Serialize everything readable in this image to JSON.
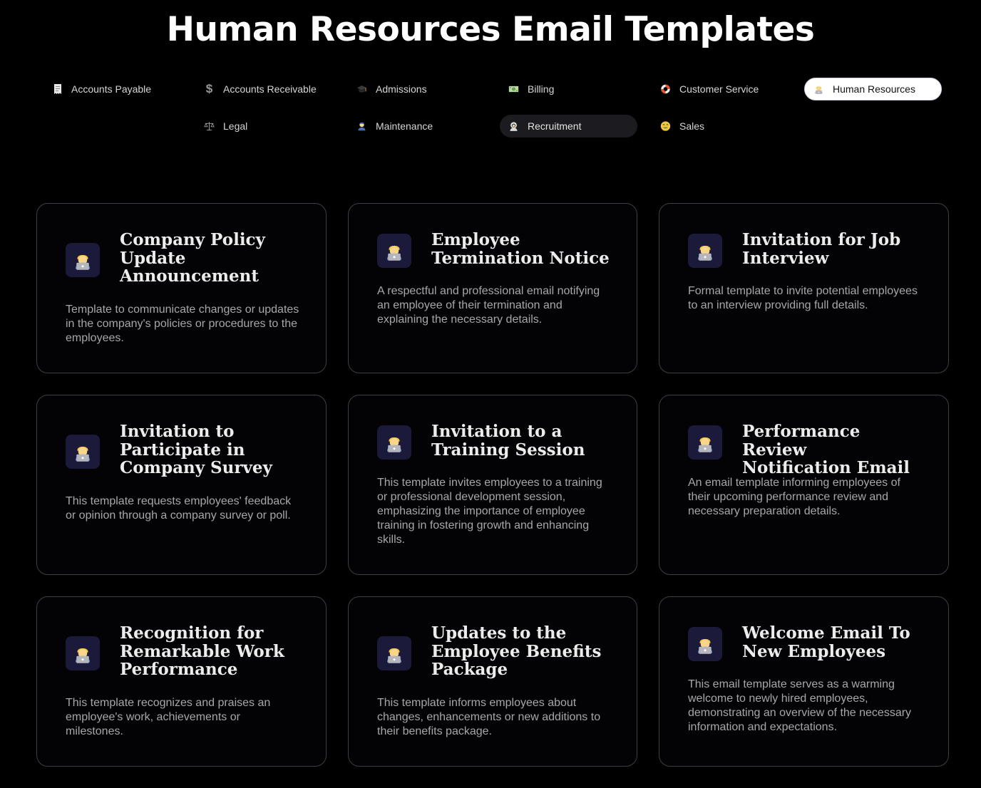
{
  "page": {
    "title": "Human Resources Email Templates"
  },
  "categories": [
    {
      "label": "Accounts Payable",
      "icon": "receipt-icon",
      "state": "normal"
    },
    {
      "label": "Accounts Receivable",
      "icon": "dollar-sign-icon",
      "state": "normal"
    },
    {
      "label": "Admissions",
      "icon": "graduation-cap-icon",
      "state": "normal"
    },
    {
      "label": "Billing",
      "icon": "dollar-banknote-icon",
      "state": "normal"
    },
    {
      "label": "Customer Service",
      "icon": "lifebuoy-icon",
      "state": "normal"
    },
    {
      "label": "Human Resources",
      "icon": "technologist-icon",
      "state": "selected"
    },
    {
      "label": "Legal",
      "icon": "balance-scale-icon",
      "state": "normal"
    },
    {
      "label": "Maintenance",
      "icon": "mechanic-icon",
      "state": "normal"
    },
    {
      "label": "Recruitment",
      "icon": "astronaut-icon",
      "state": "hovered"
    },
    {
      "label": "Sales",
      "icon": "money-mouth-face-icon",
      "state": "normal"
    }
  ],
  "templates": [
    {
      "title": "Company Policy Update Announcement",
      "description": "Template to communicate changes or updates in the company's policies or procedures to the employees.",
      "icon": "technologist-icon"
    },
    {
      "title": "Employee Termination Notice",
      "description": "A respectful and professional email notifying an employee of their termination and explaining the necessary details.",
      "icon": "technologist-icon"
    },
    {
      "title": "Invitation for Job Interview",
      "description": "Formal template to invite potential employees to an interview providing full details.",
      "icon": "technologist-icon"
    },
    {
      "title": "Invitation to Participate in Company Survey",
      "description": "This template requests employees' feedback or opinion through a company survey or poll.",
      "icon": "technologist-icon"
    },
    {
      "title": "Invitation to a Training Session",
      "description": "This template invites employees to a training or professional development session, emphasizing the importance of employee training in fostering growth and enhancing skills.",
      "icon": "technologist-icon"
    },
    {
      "title": "Performance Review Notification Email",
      "description": "An email template informing employees of their upcoming performance review and necessary preparation details.",
      "icon": "technologist-icon"
    },
    {
      "title": "Recognition for Remarkable Work Performance",
      "description": "This template recognizes and praises an employee's work, achievements or milestones.",
      "icon": "technologist-icon"
    },
    {
      "title": "Updates to the Employee Benefits Package",
      "description": "This template informs employees about changes, enhancements or new additions to their benefits package.",
      "icon": "technologist-icon"
    },
    {
      "title": "Welcome Email To New Employees",
      "description": "This email template serves as a warming welcome to newly hired employees, demonstrating an overview of the necessary information and expectations.",
      "icon": "technologist-icon"
    }
  ],
  "colors": {
    "background": "#000000",
    "card_border": "#3e3e44",
    "icon_tile": "#1b1a3a",
    "selected_pill": "#ffffff",
    "hover_pill": "#1b1b20"
  }
}
